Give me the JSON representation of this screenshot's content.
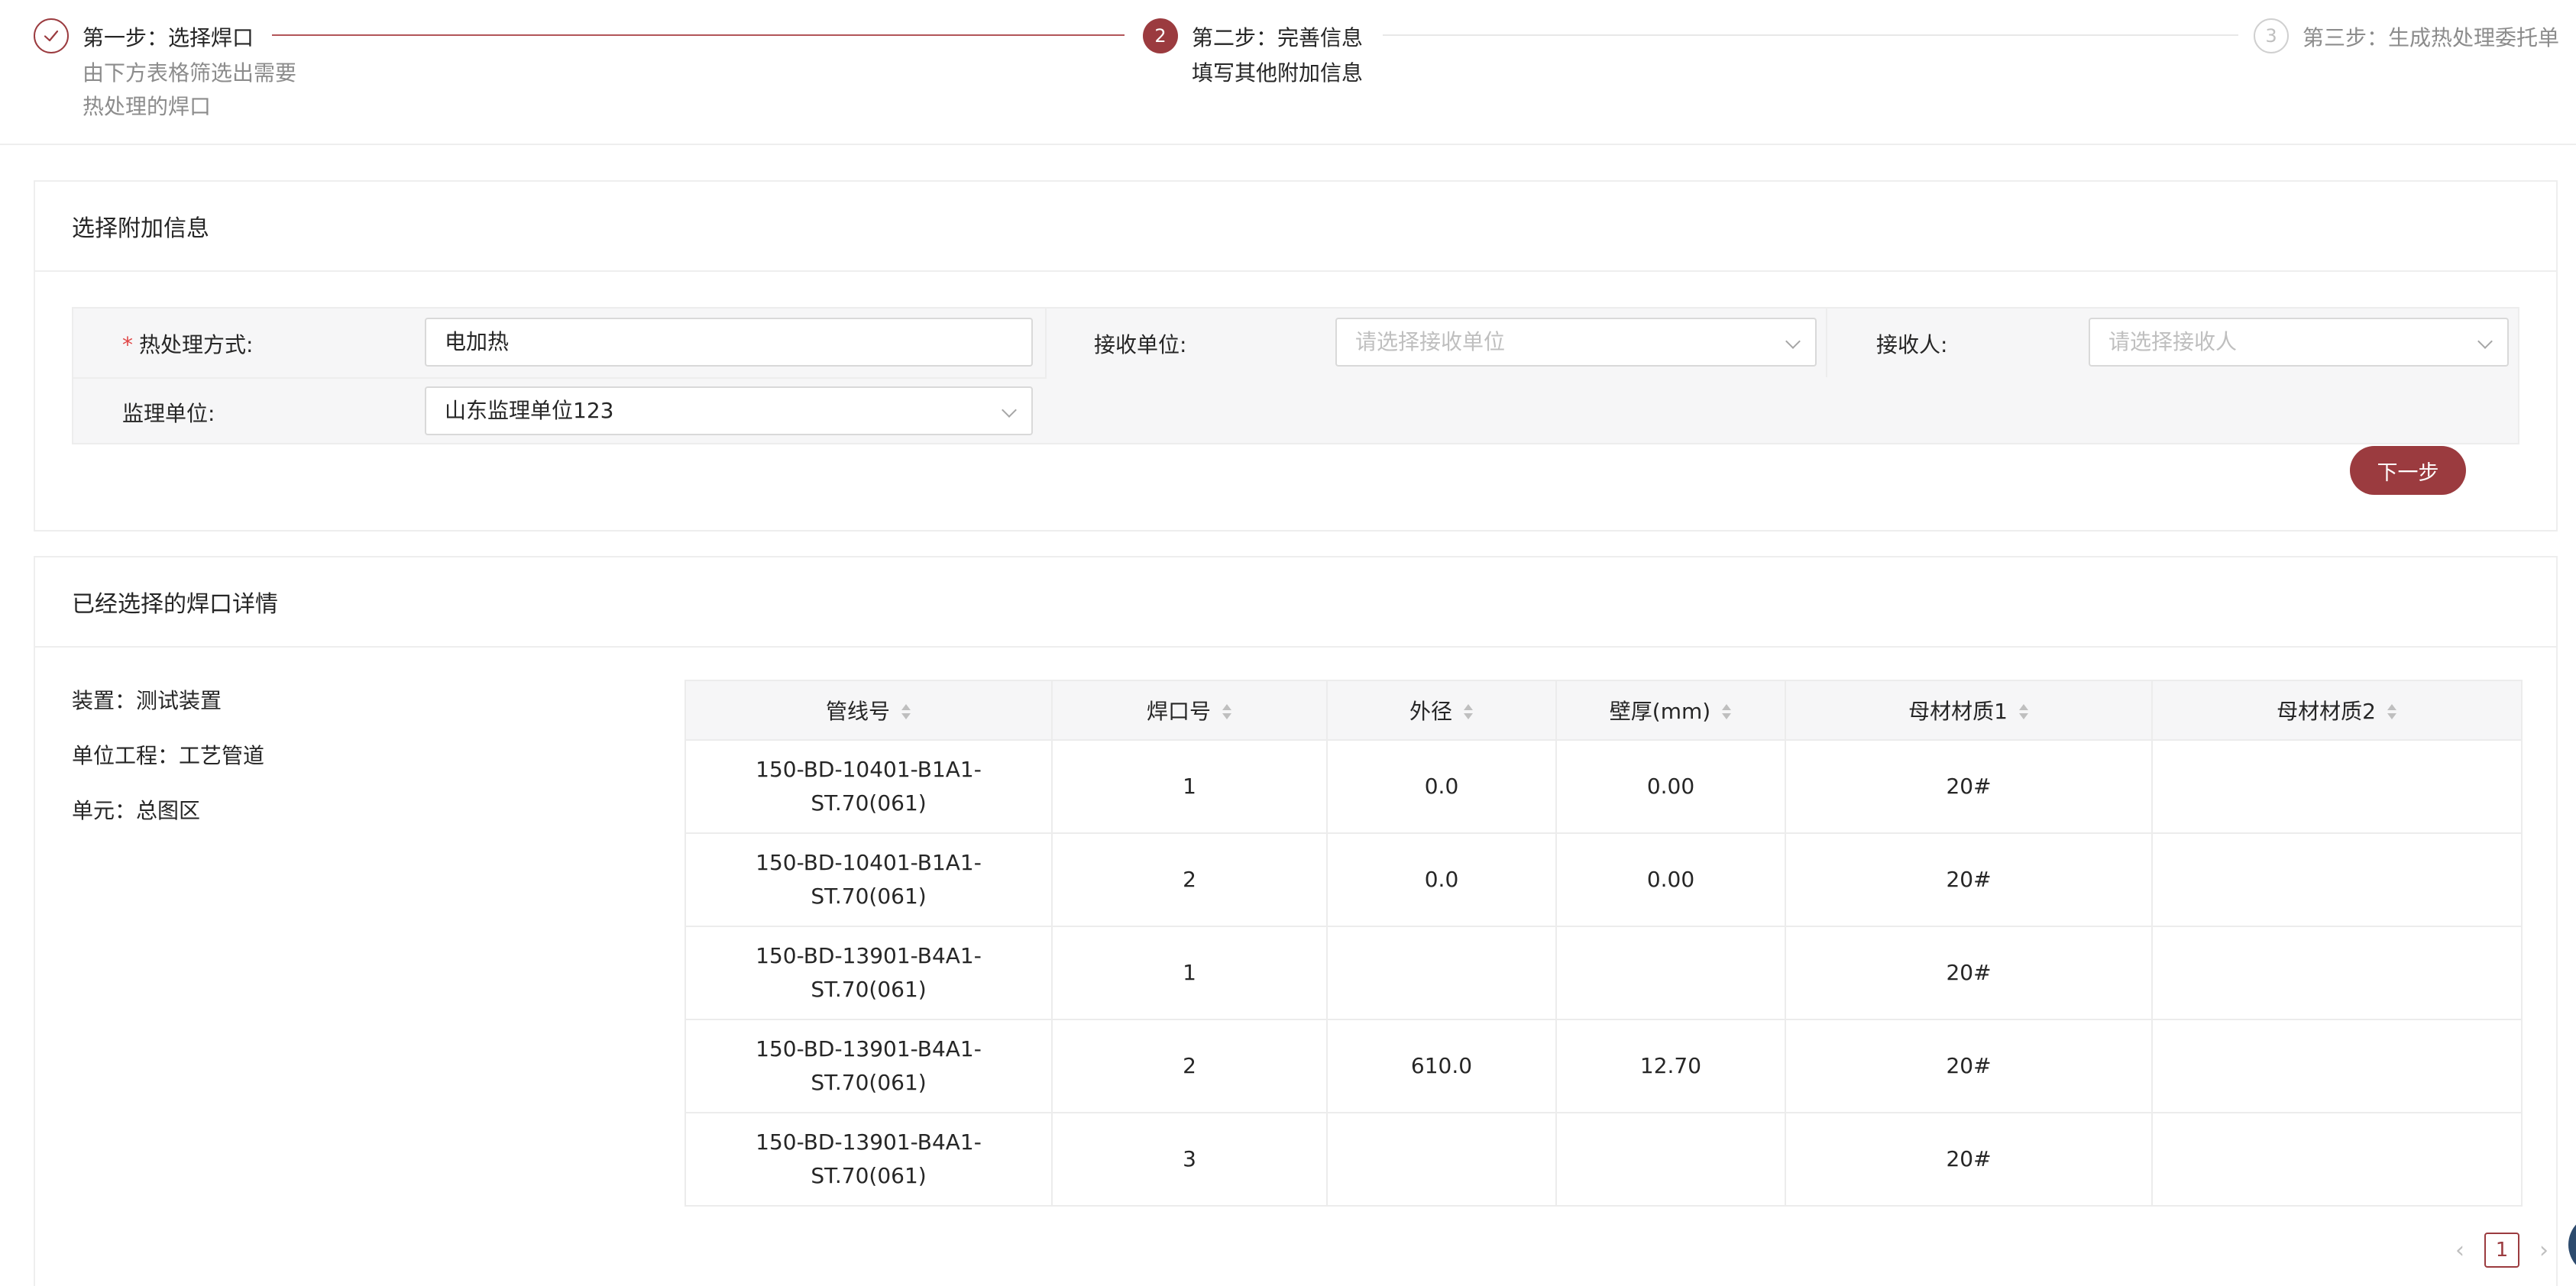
{
  "steps": [
    {
      "number": "1",
      "icon": "check-icon",
      "title": "第一步：选择焊口",
      "desc_lines": [
        "由下方表格筛选出需要",
        "热处理的焊口"
      ]
    },
    {
      "number": "2",
      "title": "第二步：完善信息",
      "desc_lines": [
        "填写其他附加信息"
      ]
    },
    {
      "number": "3",
      "title": "第三步：生成热处理委托单",
      "desc_lines": []
    }
  ],
  "form_section": {
    "title": "选择附加信息",
    "required_mark": "*",
    "fields": {
      "method": {
        "label": "热处理方式:",
        "value": "电加热"
      },
      "receiver_unit": {
        "label": "接收单位:",
        "placeholder": "请选择接收单位"
      },
      "receiver": {
        "label": "接收人:",
        "placeholder": "请选择接收人"
      },
      "supervisor_unit": {
        "label": "监理单位:",
        "value": "山东监理单位123"
      }
    },
    "next_button": "下一步"
  },
  "detail_section": {
    "title": "已经选择的焊口详情",
    "info": [
      "装置：测试装置",
      "单位工程：工艺管道",
      "单元：总图区"
    ],
    "columns": [
      "管线号",
      "焊口号",
      "外径",
      "壁厚(mm)",
      "母材材质1",
      "母材材质2"
    ],
    "rows": [
      {
        "line": [
          "150-BD-10401-B1A1-",
          "ST.70(061)"
        ],
        "weld": "1",
        "od": "0.0",
        "wt": "0.00",
        "m1": "20#",
        "m2": ""
      },
      {
        "line": [
          "150-BD-10401-B1A1-",
          "ST.70(061)"
        ],
        "weld": "2",
        "od": "0.0",
        "wt": "0.00",
        "m1": "20#",
        "m2": ""
      },
      {
        "line": [
          "150-BD-13901-B4A1-",
          "ST.70(061)"
        ],
        "weld": "1",
        "od": "",
        "wt": "",
        "m1": "20#",
        "m2": ""
      },
      {
        "line": [
          "150-BD-13901-B4A1-",
          "ST.70(061)"
        ],
        "weld": "2",
        "od": "610.0",
        "wt": "12.70",
        "m1": "20#",
        "m2": ""
      },
      {
        "line": [
          "150-BD-13901-B4A1-",
          "ST.70(061)"
        ],
        "weld": "3",
        "od": "",
        "wt": "",
        "m1": "20#",
        "m2": ""
      }
    ],
    "pagination": {
      "current": "1",
      "prev_icon": "chevron-left-icon",
      "next_icon": "chevron-right-icon"
    }
  },
  "colors": {
    "primary": "#9b3b3f",
    "border": "#eeeeee",
    "header_bg": "#f6f6f7"
  }
}
